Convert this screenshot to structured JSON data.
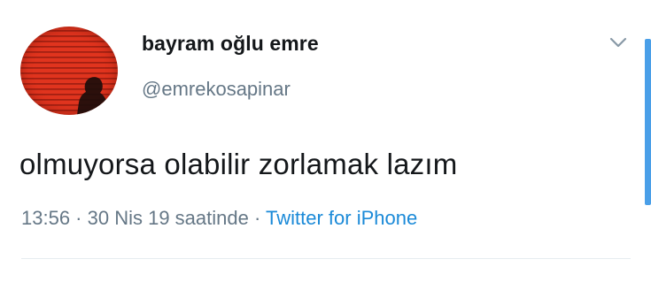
{
  "tweet": {
    "author": {
      "display_name": "bayram oğlu emre",
      "handle": "@emrekosapinar",
      "avatar_icon": "profile-photo-avatar"
    },
    "text": "olmuyorsa olabilir zorlamak lazım",
    "meta": {
      "time": "13:56",
      "separator": " · ",
      "date": "30 Nis 19 saatinde",
      "source_separator": " · ",
      "source": "Twitter for iPhone"
    },
    "menu_icon": "chevron-down-icon"
  },
  "colors": {
    "text_primary": "#14171a",
    "text_secondary": "#657786",
    "link": "#1b8ad8",
    "avatar_red": "#e0341e",
    "scroll_indicator": "#4a9fe8"
  }
}
